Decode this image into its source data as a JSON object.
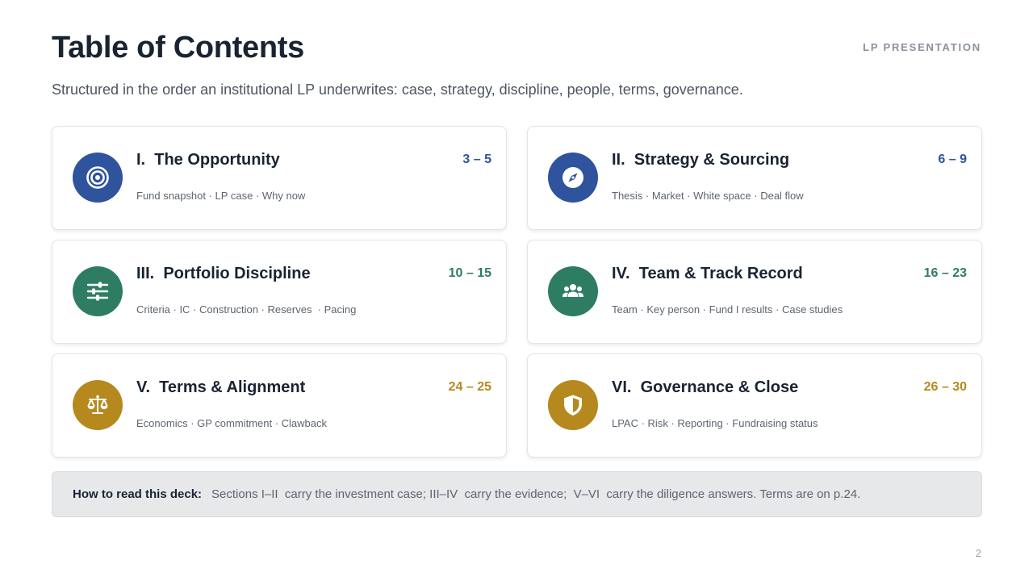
{
  "header": {
    "title": "Table of Contents",
    "tag": "LP PRESENTATION",
    "subtitle": "Structured in the order an institutional LP underwrites: case, strategy, discipline, people, terms, governance."
  },
  "sections": [
    {
      "title": "I.  The Opportunity",
      "pages": "3 – 5",
      "items": "Fund snapshot · LP case · Why now",
      "icon": "target-icon",
      "color": "#2f539c"
    },
    {
      "title": "II.  Strategy & Sourcing",
      "pages": "6 – 9",
      "items": "Thesis · Market · White space · Deal flow",
      "icon": "compass-icon",
      "color": "#2f539c"
    },
    {
      "title": "III.  Portfolio Discipline",
      "pages": "10 – 15",
      "items": "Criteria · IC · Construction · Reserves  · Pacing",
      "icon": "sliders-icon",
      "color": "#2e7d62"
    },
    {
      "title": "IV.  Team & Track Record",
      "pages": "16 – 23",
      "items": "Team · Key person · Fund I results · Case studies",
      "icon": "users-icon",
      "color": "#2e7d62"
    },
    {
      "title": "V.  Terms & Alignment",
      "pages": "24 – 25",
      "items": "Economics · GP commitment · Clawback",
      "icon": "scale-icon",
      "color": "#b5891e"
    },
    {
      "title": "VI.  Governance & Close",
      "pages": "26 – 30",
      "items": "LPAC · Risk · Reporting · Fundraising status",
      "icon": "shield-icon",
      "color": "#b5891e"
    }
  ],
  "note": {
    "label": "How to read this deck:",
    "text": "Sections I–II  carry the investment case; III–IV  carry the evidence;  V–VI  carry the diligence answers. Terms are on p.24."
  },
  "page_number": "2"
}
